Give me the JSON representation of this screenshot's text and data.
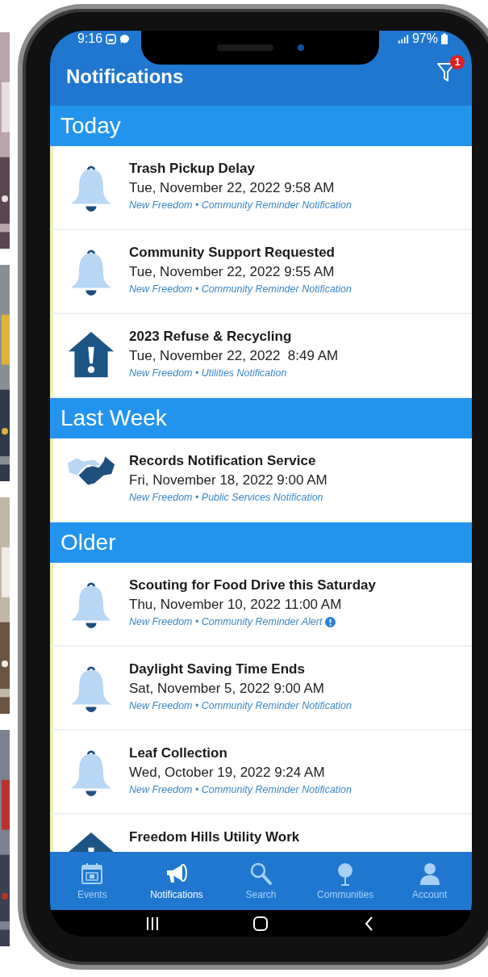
{
  "status_bar": {
    "time": "9:16",
    "battery": "97%"
  },
  "header": {
    "title": "Notifications",
    "filter_badge": "1"
  },
  "sections": [
    {
      "title": "Today",
      "items": [
        {
          "kind": "bell",
          "title": "Trash Pickup Delay",
          "date": "Tue, November 22, 2022 9:58 AM",
          "meta": "New Freedom • Community Reminder Notification",
          "alert": false
        },
        {
          "kind": "bell",
          "title": "Community Support Requested",
          "date": "Tue, November 22, 2022 9:55 AM",
          "meta": "New Freedom • Community Reminder Notification",
          "alert": false
        },
        {
          "kind": "house",
          "title": "2023 Refuse & Recycling",
          "date": "Tue, November 22, 2022  8:49 AM",
          "meta": "New Freedom • Utilities Notification",
          "alert": false
        }
      ]
    },
    {
      "title": "Last Week",
      "items": [
        {
          "kind": "handshake",
          "title": "Records Notification Service",
          "date": "Fri, November 18, 2022 9:00 AM",
          "meta": "New Freedom • Public Services Notification",
          "alert": false
        }
      ]
    },
    {
      "title": "Older",
      "items": [
        {
          "kind": "bell",
          "title": "Scouting for Food Drive this Saturday",
          "date": "Thu, November 10, 2022 11:00 AM",
          "meta": "New Freedom • Community Reminder Alert",
          "alert": true
        },
        {
          "kind": "bell",
          "title": "Daylight Saving Time Ends",
          "date": "Sat, November 5, 2022 9:00 AM",
          "meta": "New Freedom • Community Reminder Notification",
          "alert": false
        },
        {
          "kind": "bell",
          "title": "Leaf Collection",
          "date": "Wed, October 19, 2022 9:24 AM",
          "meta": "New Freedom • Community Reminder Notification",
          "alert": false
        },
        {
          "kind": "house",
          "title": "Freedom Hills Utility Work",
          "alert": false
        }
      ]
    }
  ],
  "tabs": [
    {
      "kind": "calendar",
      "label": "Events",
      "selected": false
    },
    {
      "kind": "megaphone",
      "label": "Notifications",
      "selected": true
    },
    {
      "kind": "search",
      "label": "Search",
      "selected": false
    },
    {
      "kind": "tree",
      "label": "Communities",
      "selected": false
    },
    {
      "kind": "person",
      "label": "Account",
      "selected": false
    }
  ]
}
